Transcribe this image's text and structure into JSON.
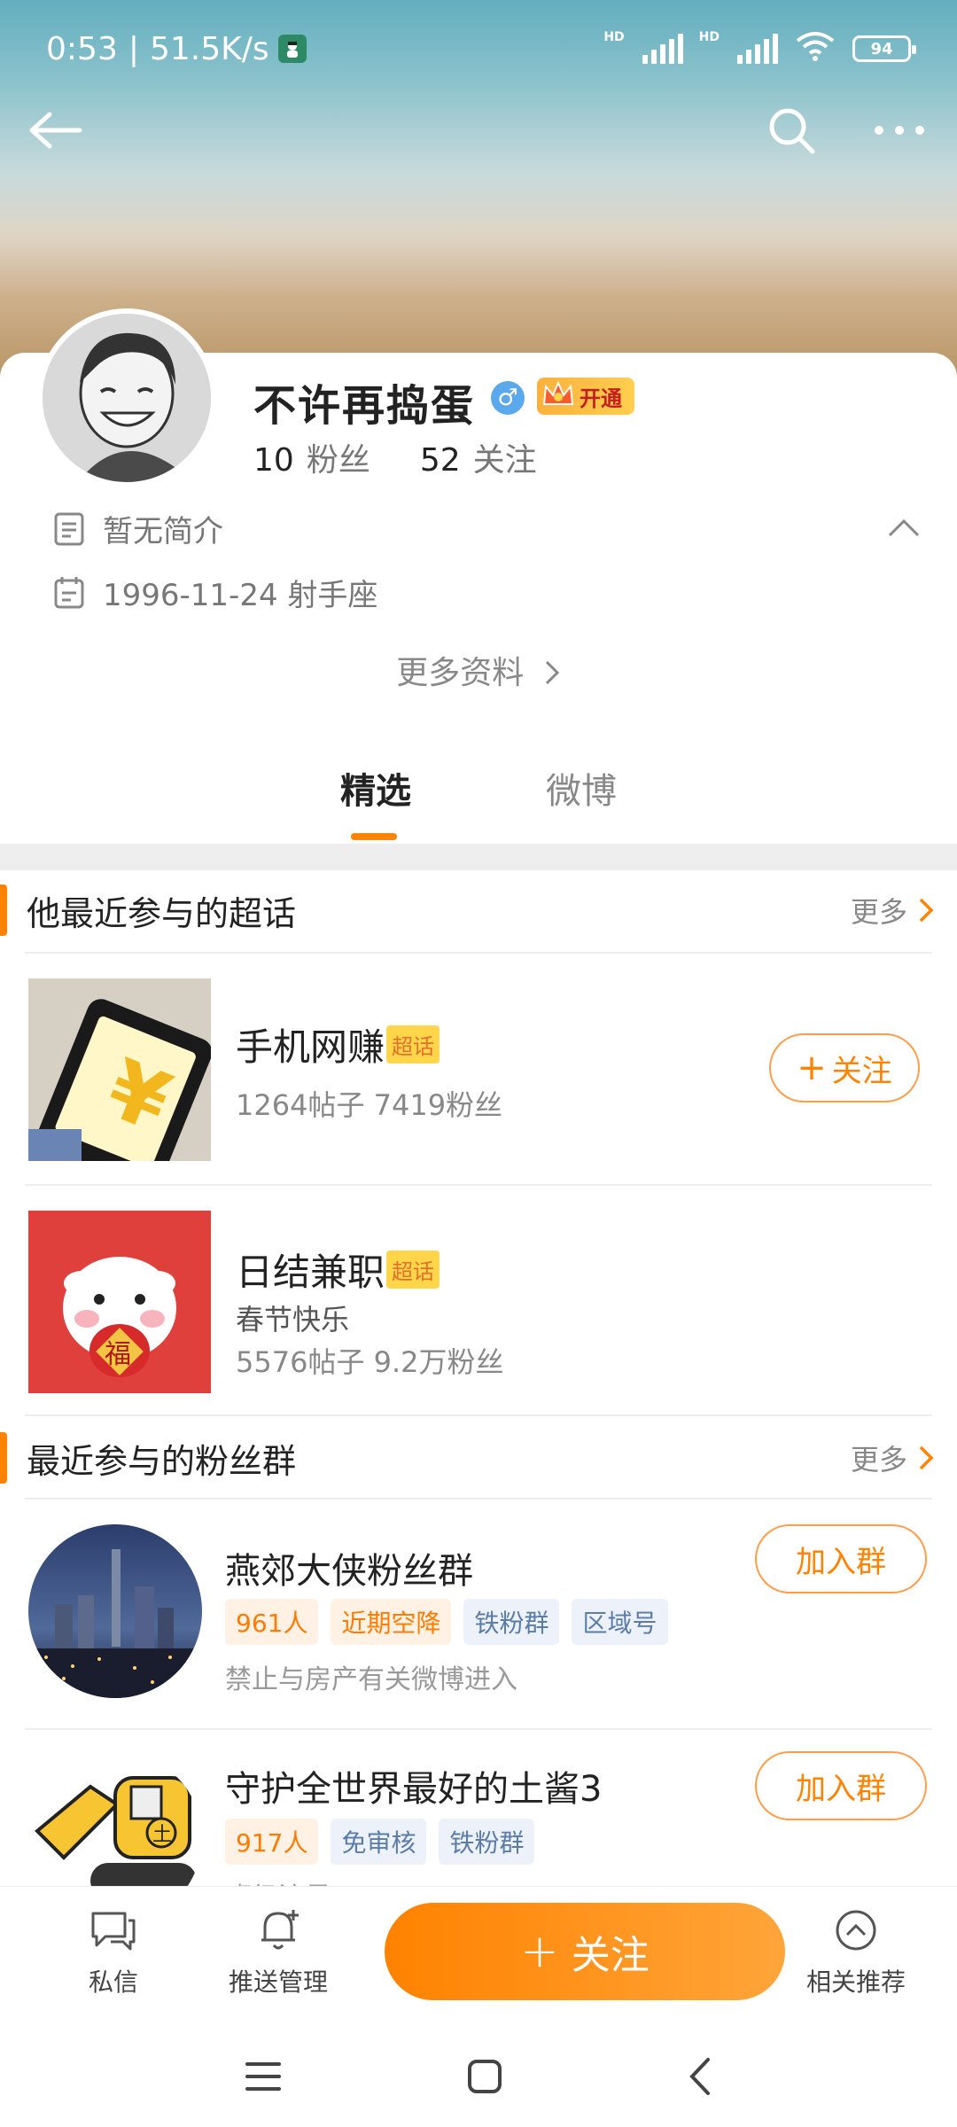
{
  "status_bar": {
    "time": "0:53",
    "net_speed": "51.5K/s",
    "battery": "94",
    "hd1": "HD",
    "hd2": "HD"
  },
  "header": {
    "back_icon": "arrow-left-icon",
    "search_icon": "search-icon",
    "more_icon": "more-dots-icon"
  },
  "profile": {
    "name": "不许再捣蛋",
    "gender_symbol": "♂",
    "vip_label": "开通",
    "fans_count": "10",
    "fans_label": "粉丝",
    "follow_count": "52",
    "follow_label": "关注",
    "bio": "暂无简介",
    "birthday": "1996-11-24 射手座",
    "more_info": "更多资料"
  },
  "tabs": [
    {
      "label": "精选",
      "active": true
    },
    {
      "label": "微博",
      "active": false
    }
  ],
  "super_topics": {
    "title": "他最近参与的超话",
    "more": "更多",
    "items": [
      {
        "title": "手机网赚",
        "badge": "超话",
        "stats": "1264帖子 7419粉丝",
        "button": "关注"
      },
      {
        "title": "日结兼职",
        "badge": "超话",
        "extra": "春节快乐",
        "stats": "5576帖子 9.2万粉丝",
        "thumb_char": "福"
      }
    ]
  },
  "fan_groups": {
    "title": "最近参与的粉丝群",
    "more": "更多",
    "items": [
      {
        "title": "燕郊大侠粉丝群",
        "tags": [
          "961人",
          "近期空降",
          "铁粉群",
          "区域号"
        ],
        "desc": "禁止与房产有关微博进入",
        "button": "加入群"
      },
      {
        "title": "守护全世界最好的土酱3",
        "tags": [
          "917人",
          "免审核",
          "铁粉群"
        ],
        "desc": "班级流量",
        "button": "加入群",
        "thumb_char": "土"
      }
    ]
  },
  "bottom_bar": {
    "message": "私信",
    "push": "推送管理",
    "follow": "关注",
    "recommend": "相关推荐"
  },
  "colors": {
    "accent": "#ff8200",
    "tag_orange_bg": "#fff1e4",
    "tag_blue_bg": "#edf2fa"
  }
}
